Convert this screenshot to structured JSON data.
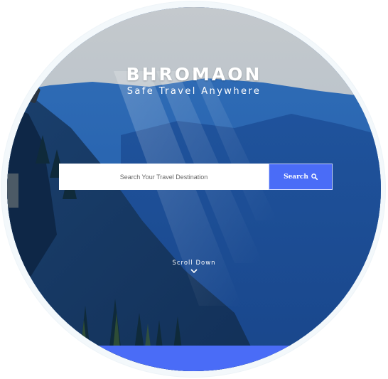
{
  "hero": {
    "title": "BHROMAON",
    "tagline": "Safe Travel Anywhere"
  },
  "search": {
    "placeholder": "Search Your Travel Destination",
    "value": "",
    "button_label": "Search",
    "button_icon": "search-icon"
  },
  "scroll": {
    "label": "Scroll Down",
    "icon": "chevron-down-icon"
  },
  "colors": {
    "accent": "#4a6cf7",
    "sky": "#b9c4cc",
    "mountain": "#1b4f9e"
  }
}
